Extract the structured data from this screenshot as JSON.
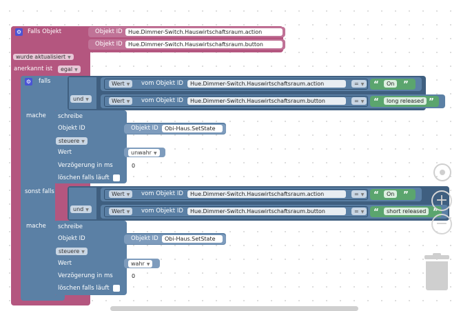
{
  "trigger": {
    "title": "Falls Objekt",
    "objekt_id_label": "Objekt ID",
    "object_ids": [
      "Hue.Dimmer-Switch.Hauswirtschaftsraum.action",
      "Hue.Dimmer-Switch.Hauswirtschaftsraum.button"
    ],
    "wurde_label": "wurde aktualisiert",
    "anerkannt_label": "anerkannt ist",
    "anerkannt_value": "egal"
  },
  "if1": {
    "falls_label": "falls",
    "und_label": "und",
    "cond": [
      {
        "wert": "Wert",
        "vom": "vom Objekt ID",
        "id": "Hue.Dimmer-Switch.Hauswirtschaftsraum.action",
        "op": "=",
        "value": "On"
      },
      {
        "wert": "Wert",
        "vom": "vom Objekt ID",
        "id": "Hue.Dimmer-Switch.Hauswirtschaftsraum.button",
        "op": "=",
        "value": "long released"
      }
    ],
    "mache_label": "mache",
    "sorst_label": "sonst falls",
    "action1": {
      "schreibe": "schreibe",
      "objekt_id": "Objekt ID",
      "objekt_id_field": "Objekt ID",
      "target": "Obi-Haus.SetState",
      "steuere": "steuere",
      "wert": "Wert",
      "wert_value": "unwahr",
      "verz": "Verzögerung in ms",
      "verz_value": "0",
      "loeschen": "löschen falls läuft"
    },
    "action2": {
      "schreibe": "schreibe",
      "objekt_id": "Objekt ID",
      "objekt_id_field": "Objekt ID",
      "target": "Obi-Haus.SetState",
      "steuere": "steuere",
      "wert": "Wert",
      "wert_value": "wahr",
      "verz": "Verzögerung in ms",
      "verz_value": "0",
      "loeschen": "löschen falls läuft"
    },
    "cond2": [
      {
        "wert": "Wert",
        "vom": "vom Objekt ID",
        "id": "Hue.Dimmer-Switch.Hauswirtschaftsraum.action",
        "op": "=",
        "value": "On"
      },
      {
        "wert": "Wert",
        "vom": "vom Objekt ID",
        "id": "Hue.Dimmer-Switch.Hauswirtschaftsraum.button",
        "op": "=",
        "value": "short released"
      }
    ],
    "und2_label": "und"
  },
  "controls": {
    "center": "center-icon",
    "zoom_in": "+",
    "zoom_out": "−",
    "trash": "trash-icon"
  }
}
